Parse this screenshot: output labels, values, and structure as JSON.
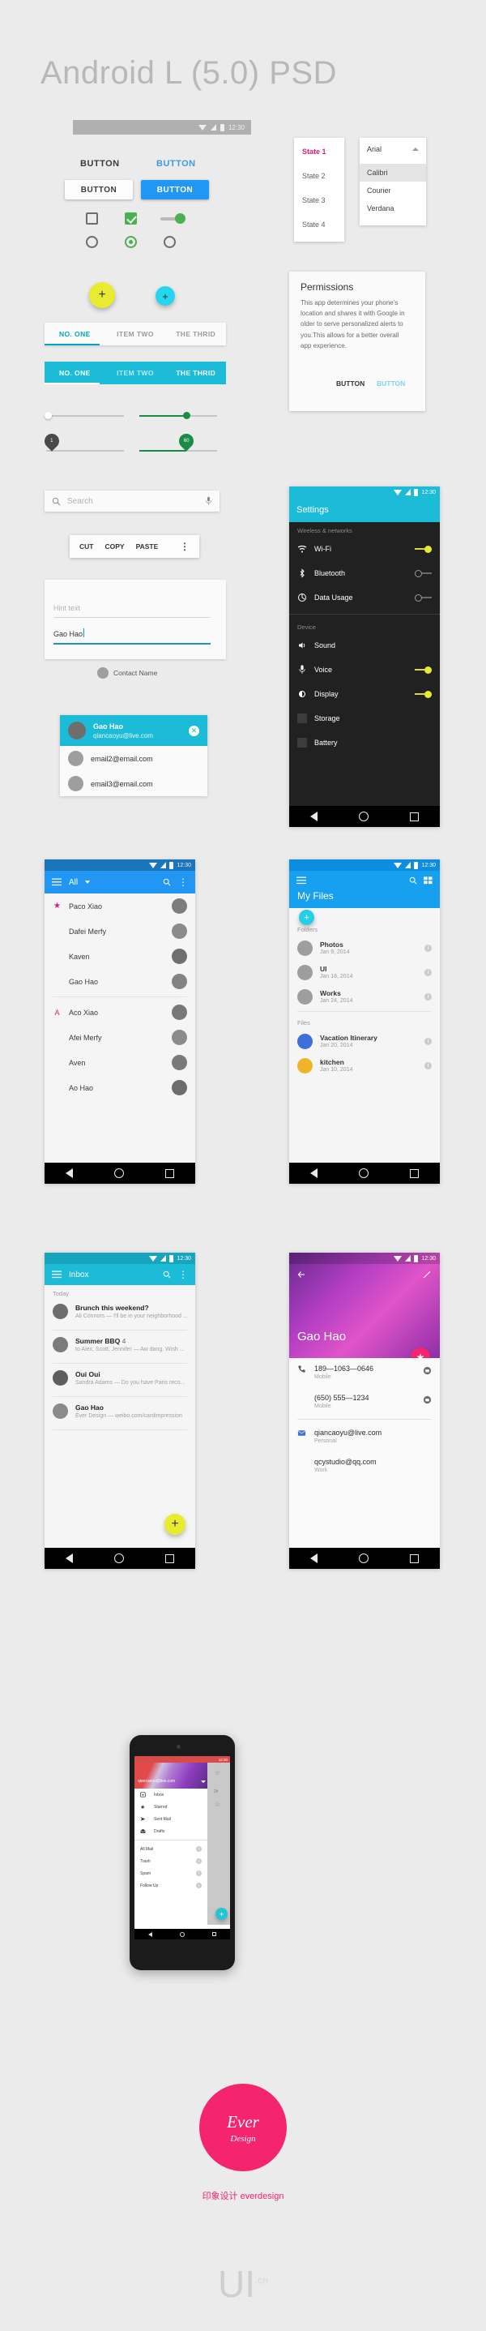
{
  "page": {
    "title": "Android L (5.0) PSD"
  },
  "colors": {
    "cyan": "#00b8d4",
    "blue": "#2196f3",
    "yellow": "#e8eb2f",
    "pink": "#f4246f",
    "green": "#1b8b46",
    "dark": "#212121"
  },
  "status_bar": {
    "time": "12:30",
    "icons": [
      "wifi-icon",
      "signal-icon",
      "battery-icon"
    ]
  },
  "buttons": {
    "flat_dark": "BUTTON",
    "flat_blue": "BUTTON",
    "raised_light": "BUTTON",
    "raised_blue": "BUTTON"
  },
  "states": {
    "items": [
      "State 1",
      "State 2",
      "State 3",
      "State 4"
    ]
  },
  "font_dropdown": {
    "selected": "Arial",
    "options": [
      "Calibri",
      "Courier",
      "Verdana"
    ]
  },
  "dialog": {
    "title": "Permissions",
    "body": "This app determines your phone's location and shares it with Google in older to serve personalized alerts to you.This allows for a better overall app experience.",
    "cancel": "BUTTON",
    "confirm": "BUTTON"
  },
  "tabs": {
    "items": [
      "NO. ONE",
      "ITEM TWO",
      "THE THRID"
    ],
    "selected": 0
  },
  "sliders": {
    "left_value": "1",
    "right_value": "60"
  },
  "search": {
    "placeholder": "Search",
    "icon": "search-icon",
    "mic": "mic-icon"
  },
  "text_toolbar": {
    "items": [
      "CUT",
      "COPY",
      "PASTE"
    ],
    "overflow": "overflow-icon"
  },
  "textfields": {
    "hint": "Hint text",
    "value": "Gao Hao"
  },
  "contact_chip": {
    "label": "Contact Name"
  },
  "account_picker": {
    "primary": {
      "name": "Gao Hao",
      "email": "qiancaoyu@live.com"
    },
    "others": [
      "email2@email.com",
      "email3@email.com"
    ]
  },
  "settings": {
    "title": "Settings",
    "time": "12:30",
    "group_wireless": "Wireless & networks",
    "group_device": "Device",
    "rows": [
      {
        "label": "Wi-Fi",
        "icon": "wifi-icon",
        "toggle": "on"
      },
      {
        "label": "Bluetooth",
        "icon": "bluetooth-icon",
        "toggle": "off"
      },
      {
        "label": "Data Usage",
        "icon": "data-icon",
        "toggle": "off"
      },
      {
        "label": "Sound",
        "icon": "sound-icon",
        "toggle": "none"
      },
      {
        "label": "Voice",
        "icon": "mic-icon",
        "toggle": "on"
      },
      {
        "label": "Display",
        "icon": "brightness-icon",
        "toggle": "on"
      },
      {
        "label": "Storage",
        "icon": "storage-icon",
        "toggle": "none"
      },
      {
        "label": "Battery",
        "icon": "battery-icon",
        "toggle": "none"
      }
    ]
  },
  "contacts": {
    "title": "All",
    "time": "12:30",
    "groups": [
      {
        "letter": "",
        "rows": [
          "Paco Xiao",
          "Dafei Merfy",
          "Kaven",
          "Gao Hao"
        ]
      },
      {
        "letter": "A",
        "rows": [
          "Aco Xiao",
          "Afei Merfy",
          "Aven",
          "Ao Hao"
        ]
      }
    ]
  },
  "myfiles": {
    "title": "My Files",
    "time": "12:30",
    "section_folders": "Folders",
    "section_files": "Files",
    "folders": [
      {
        "name": "Photos",
        "date": "Jan 9, 2014"
      },
      {
        "name": "UI",
        "date": "Jan 18, 2014"
      },
      {
        "name": "Works",
        "date": "Jan 24, 2014"
      }
    ],
    "files": [
      {
        "name": "Vacation Itinerary",
        "date": "Jan 20, 2014"
      },
      {
        "name": "kitchen",
        "date": "Jan 10, 2014"
      }
    ]
  },
  "inbox": {
    "title": "Inbox",
    "time": "12:30",
    "section": "Today",
    "rows": [
      {
        "subject": "Brunch this weekend?",
        "preview": "Ali Connors — I'll be in your neighborhood ..."
      },
      {
        "subject": "Summer BBQ",
        "count": "4",
        "preview": "to Alex, Scott, Jennifer — Aw dang. Wish ..."
      },
      {
        "subject": "Oui Oui",
        "preview": "Sandra Adams — Do you have Paris reco..."
      },
      {
        "subject": "Gao Hao",
        "preview": "Ever Design — weibo.com/cardimpression"
      }
    ]
  },
  "contact_detail": {
    "time": "12:30",
    "name": "Gao Hao",
    "entries": [
      {
        "value": "189—1063—0646",
        "label": "Mobile",
        "action": "message-icon"
      },
      {
        "value": "(650) 555—1234",
        "label": "Mobile",
        "action": "message-icon"
      },
      {
        "value": "qiancaoyu@live.com",
        "label": "Personal",
        "action": ""
      },
      {
        "value": "qcystudio@qq.com",
        "label": "Work",
        "action": ""
      }
    ],
    "fab": "star-icon",
    "edit": "pencil-icon",
    "back": "back-arrow-icon"
  },
  "drawer": {
    "account": "qiancaoyu@live.com",
    "primary": [
      {
        "label": "Inbox",
        "icon": "inbox-icon"
      },
      {
        "label": "Starred",
        "icon": "star-icon"
      },
      {
        "label": "Sent Mail",
        "icon": "send-icon"
      },
      {
        "label": "Drafts",
        "icon": "drafts-icon"
      }
    ],
    "secondary": [
      {
        "label": "All Mail"
      },
      {
        "label": "Trash"
      },
      {
        "label": "Spam"
      },
      {
        "label": "Follow Up"
      }
    ],
    "time": "12:30"
  },
  "footer": {
    "logo_line1": "Ever",
    "logo_line2": "Design",
    "tagline": "印象设计 everdesign",
    "watermark": "UI",
    "watermark_sub": ".cn"
  }
}
